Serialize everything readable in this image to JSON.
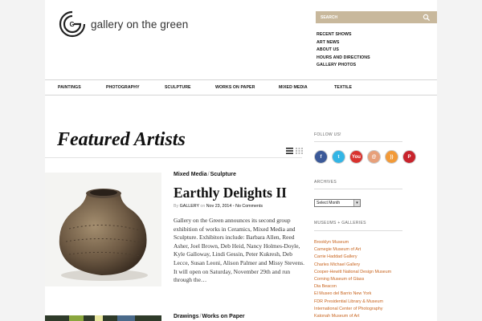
{
  "site": {
    "name": "gallery on the green"
  },
  "search": {
    "placeholder": "SEARCH"
  },
  "top_links": [
    "RECENT SHOWS",
    "ART NEWS",
    "ABOUT US",
    "HOURS AND DIRECTIONS",
    "GALLERY PHOTOS"
  ],
  "nav": [
    "PAINTINGS",
    "PHOTOGRAPHY",
    "SCULPTURE",
    "WORKS ON PAPER",
    "MIXED MEDIA",
    "TEXTILE"
  ],
  "main": {
    "heading": "Featured Artists",
    "posts": [
      {
        "categories": [
          "Mixed Media",
          "Sculpture"
        ],
        "title": "Earthly Delights II",
        "by_label": "By",
        "author": "GALLERY",
        "on_label": "on",
        "date": "Nov 23, 2014",
        "comments": "No Comments",
        "excerpt": "Gallery on the Green announces its second group exhibition of works in Ceramics, Mixed Media and Sculpture. Exhibitors include: Barbara Allen, Reed Asher, Joel Brown, Deb Heid, Nancy Holmes-Doyle, Kyle Galloway, Lindi Gessin, Peter Kukresh, Deb Lecce, Susan Leoni, Alison Palmer and Missy Stevens. It will open on Saturday, November 29th and run through the…"
      },
      {
        "categories": [
          "Drawings",
          "Works on Paper"
        ]
      }
    ]
  },
  "sidebar": {
    "follow_heading": "FOLLOW US!",
    "social": [
      {
        "icon": "facebook-icon",
        "glyph": "f",
        "color": "#3b5998"
      },
      {
        "icon": "twitter-icon",
        "glyph": "t",
        "color": "#33b5e5"
      },
      {
        "icon": "youtube-icon",
        "glyph": "You",
        "color": "#d8322e"
      },
      {
        "icon": "email-icon",
        "glyph": "@",
        "color": "#e7a07a"
      },
      {
        "icon": "rss-icon",
        "glyph": "))",
        "color": "#f29a38"
      },
      {
        "icon": "pinterest-icon",
        "glyph": "P",
        "color": "#c8232c"
      }
    ],
    "archives_heading": "ARCHIVES",
    "archive_select": "Select Month",
    "museums_heading": "MUSEUMS + GALLERIES",
    "museums": [
      "Brooklyn Museum",
      "Carnegie Museum of Art",
      "Carrie Haddad Gallery",
      "Charles Michael Gallery",
      "Cooper-Hewitt National Design Museum",
      "Corning Museum of Glass",
      "Dia Beacon",
      "El Museo del Barrio New York",
      "FDR Presidential Library & Museum",
      "International Center of Photography",
      "Katonah Museum of Art"
    ]
  },
  "colors": {
    "accent": "#c8b89c",
    "link": "#c8641e"
  }
}
